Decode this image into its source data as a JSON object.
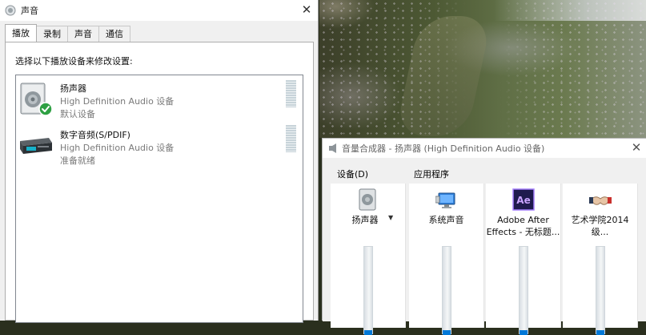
{
  "sound_window": {
    "title": "声音",
    "close_label": "✕",
    "tabs": [
      {
        "label": "播放",
        "active": true
      },
      {
        "label": "录制",
        "active": false
      },
      {
        "label": "声音",
        "active": false
      },
      {
        "label": "通信",
        "active": false
      }
    ],
    "instruction": "选择以下播放设备来修改设置:",
    "devices": [
      {
        "name": "扬声器",
        "driver": "High Definition Audio 设备",
        "status": "默认设备",
        "icon": "speaker-icon",
        "default": true
      },
      {
        "name": "数字音频(S/PDIF)",
        "driver": "High Definition Audio 设备",
        "status": "准备就绪",
        "icon": "digital-audio-icon",
        "default": false
      }
    ]
  },
  "mixer_window": {
    "title": "音量合成器 - 扬声器 (High Definition Audio 设备)",
    "close_label": "✕",
    "device_group_label": "设备(D)",
    "apps_group_label": "应用程序",
    "columns": [
      {
        "label": "扬声器",
        "icon": "speaker-icon",
        "has_dropdown": true,
        "volume": 0.05
      },
      {
        "label": "系统声音",
        "icon": "system-sounds-icon",
        "has_dropdown": false,
        "volume": 0.05
      },
      {
        "label": "Adobe After Effects - 无标题...",
        "label_line1": "Adobe After",
        "label_line2": "Effects - 无标题...",
        "icon": "after-effects-icon",
        "has_dropdown": false,
        "volume": 0.05
      },
      {
        "label": "艺术学院2014级...",
        "icon": "app-handshake-icon",
        "has_dropdown": false,
        "volume": 0.05
      }
    ]
  },
  "colors": {
    "accent": "#0078d7",
    "ae_purple": "#1f1a4d",
    "ae_text": "#c9a3ff",
    "check_green": "#2ea043",
    "secondary_text": "#7a7a7a"
  }
}
